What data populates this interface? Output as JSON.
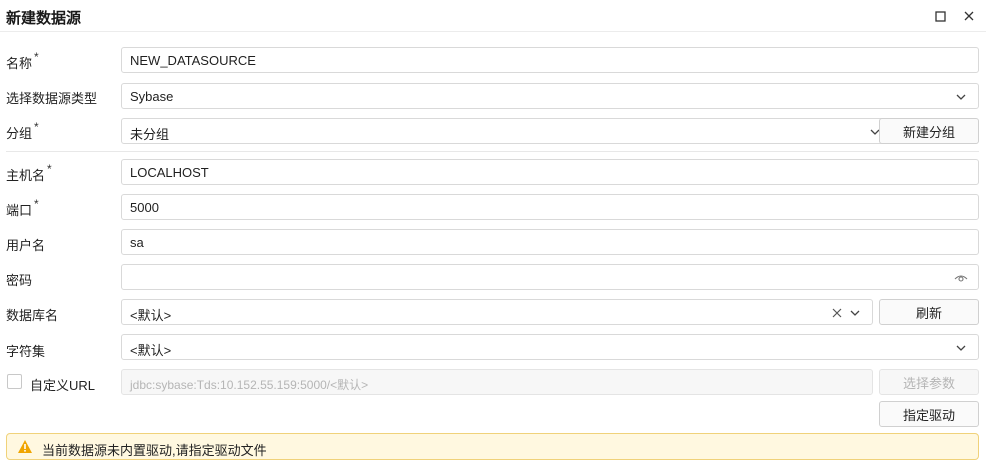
{
  "dialog": {
    "title": "新建数据源",
    "maximize_icon": "maximize-icon",
    "close_icon": "close-icon"
  },
  "form": {
    "name": {
      "label": "名称",
      "required_mark": "*",
      "value": "NEW_DATASOURCE"
    },
    "type": {
      "label": "选择数据源类型",
      "value": "Sybase"
    },
    "group": {
      "label": "分组",
      "required_mark": "*",
      "value": "未分组",
      "button": "新建分组"
    },
    "host": {
      "label": "主机名",
      "required_mark": "*",
      "value": "LOCALHOST"
    },
    "port": {
      "label": "端口",
      "required_mark": "*",
      "value": "5000"
    },
    "username": {
      "label": "用户名",
      "value": "sa"
    },
    "password": {
      "label": "密码",
      "value": ""
    },
    "database": {
      "label": "数据库名",
      "value": "<默认>",
      "button": "刷新"
    },
    "charset": {
      "label": "字符集",
      "value": "<默认>"
    },
    "custom_url": {
      "label": "自定义URL",
      "checked": false,
      "value": "jdbc:sybase:Tds:10.152.55.159:5000/<默认>",
      "button": "选择参数"
    },
    "driver_button": "指定驱动"
  },
  "warning": {
    "text": "当前数据源未内置驱动,请指定驱动文件",
    "color": "#f0a500"
  },
  "colors": {
    "border": "#d9d9d9",
    "warning_bg": "#fff8e0",
    "warning_border": "#f0d27a"
  }
}
